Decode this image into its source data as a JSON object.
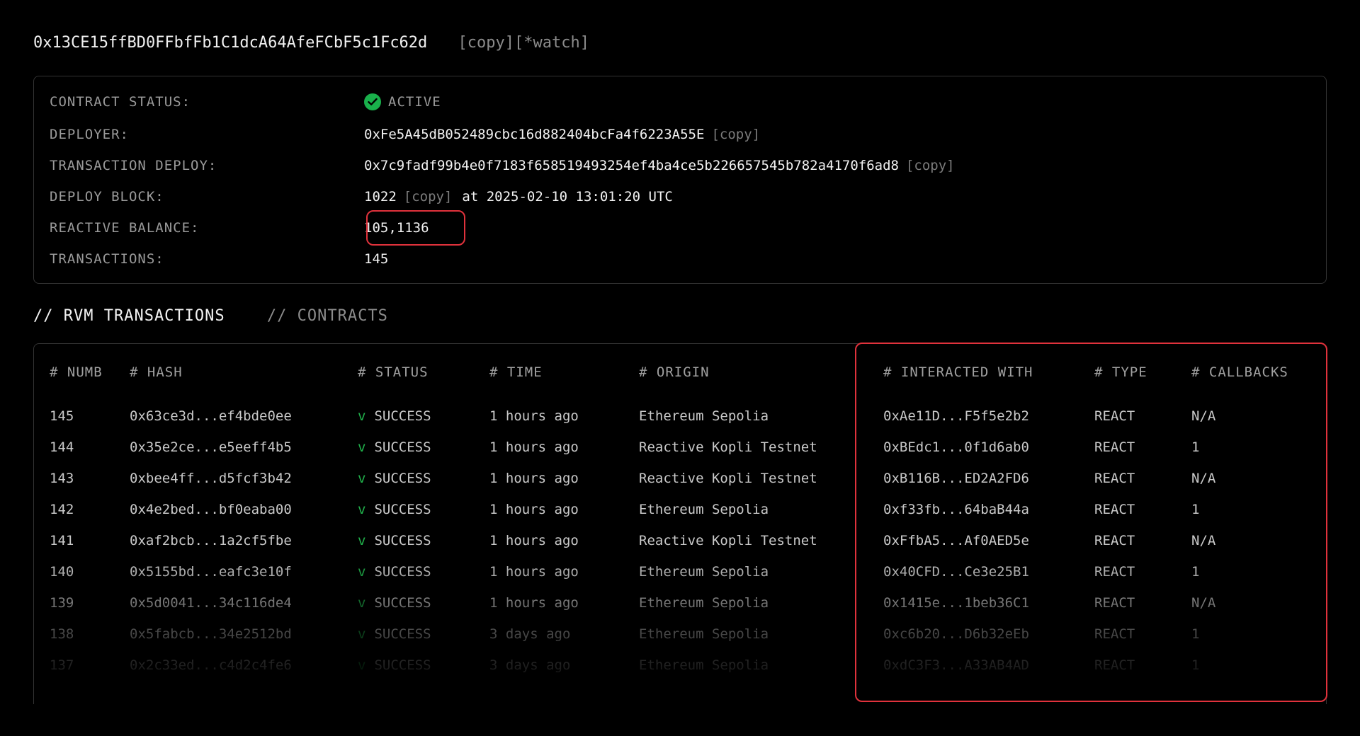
{
  "header": {
    "address": "0x13CE15ffBD0FFbfFb1C1dcA64AfeFCbF5c1Fc62d",
    "copy_label": "[copy]",
    "watch_label": "[*watch]"
  },
  "status": {
    "contract_status_label": "CONTRACT STATUS:",
    "contract_status_value": "ACTIVE",
    "deployer_label": "DEPLOYER:",
    "deployer_value": "0xFe5A45dB052489cbc16d882404bcFa4f6223A55E",
    "transaction_deploy_label": "TRANSACTION DEPLOY:",
    "transaction_deploy_value": "0x7c9fadf99b4e0f7183f658519493254ef4ba4ce5b226657545b782a4170f6ad8",
    "deploy_block_label": "DEPLOY BLOCK:",
    "deploy_block_value": "1022",
    "deploy_block_time": "at 2025-02-10 13:01:20 UTC",
    "reactive_balance_label": "REACTIVE BALANCE:",
    "reactive_balance_value": "105,1136",
    "transactions_label": "TRANSACTIONS:",
    "transactions_value": "145",
    "copy_label": "[copy]"
  },
  "tabs": [
    {
      "label": "// RVM TRANSACTIONS",
      "active": true
    },
    {
      "label": "// CONTRACTS",
      "active": false
    }
  ],
  "table": {
    "columns": [
      "# NUMB",
      "# HASH",
      "# STATUS",
      "# TIME",
      "# ORIGIN",
      "# INTERACTED WITH",
      "# TYPE",
      "# CALLBACKS"
    ],
    "status_mark": "v",
    "rows": [
      {
        "numb": "145",
        "hash": "0x63ce3d...ef4bde0ee",
        "status": "SUCCESS",
        "time": "1 hours ago",
        "origin": "Ethereum Sepolia",
        "interacted": "0xAe11D...F5f5e2b2",
        "type": "REACT",
        "callbacks": "N/A"
      },
      {
        "numb": "144",
        "hash": "0x35e2ce...e5eeff4b5",
        "status": "SUCCESS",
        "time": "1 hours ago",
        "origin": "Reactive Kopli Testnet",
        "interacted": "0xBEdc1...0f1d6ab0",
        "type": "REACT",
        "callbacks": "1"
      },
      {
        "numb": "143",
        "hash": "0xbee4ff...d5fcf3b42",
        "status": "SUCCESS",
        "time": "1 hours ago",
        "origin": "Reactive Kopli Testnet",
        "interacted": "0xB116B...ED2A2FD6",
        "type": "REACT",
        "callbacks": "N/A"
      },
      {
        "numb": "142",
        "hash": "0x4e2bed...bf0eaba00",
        "status": "SUCCESS",
        "time": "1 hours ago",
        "origin": "Ethereum Sepolia",
        "interacted": "0xf33fb...64baB44a",
        "type": "REACT",
        "callbacks": "1"
      },
      {
        "numb": "141",
        "hash": "0xaf2bcb...1a2cf5fbe",
        "status": "SUCCESS",
        "time": "1 hours ago",
        "origin": "Reactive Kopli Testnet",
        "interacted": "0xFfbA5...Af0AED5e",
        "type": "REACT",
        "callbacks": "N/A"
      },
      {
        "numb": "140",
        "hash": "0x5155bd...eafc3e10f",
        "status": "SUCCESS",
        "time": "1 hours ago",
        "origin": "Ethereum Sepolia",
        "interacted": "0x40CFD...Ce3e25B1",
        "type": "REACT",
        "callbacks": "1"
      },
      {
        "numb": "139",
        "hash": "0x5d0041...34c116de4",
        "status": "SUCCESS",
        "time": "1 hours ago",
        "origin": "Ethereum Sepolia",
        "interacted": "0x1415e...1beb36C1",
        "type": "REACT",
        "callbacks": "N/A"
      },
      {
        "numb": "138",
        "hash": "0x5fabcb...34e2512bd",
        "status": "SUCCESS",
        "time": "3 days ago",
        "origin": "Ethereum Sepolia",
        "interacted": "0xc6b20...D6b32eEb",
        "type": "REACT",
        "callbacks": "1"
      },
      {
        "numb": "137",
        "hash": "0x2c33ed...c4d2c4fe6",
        "status": "SUCCESS",
        "time": "3 days ago",
        "origin": "Ethereum Sepolia",
        "interacted": "0xdC3F3...A33AB4AD",
        "type": "REACT",
        "callbacks": "1"
      }
    ]
  },
  "colors": {
    "background": "#000000",
    "success": "#20b04a",
    "highlight": "#e0323c"
  }
}
